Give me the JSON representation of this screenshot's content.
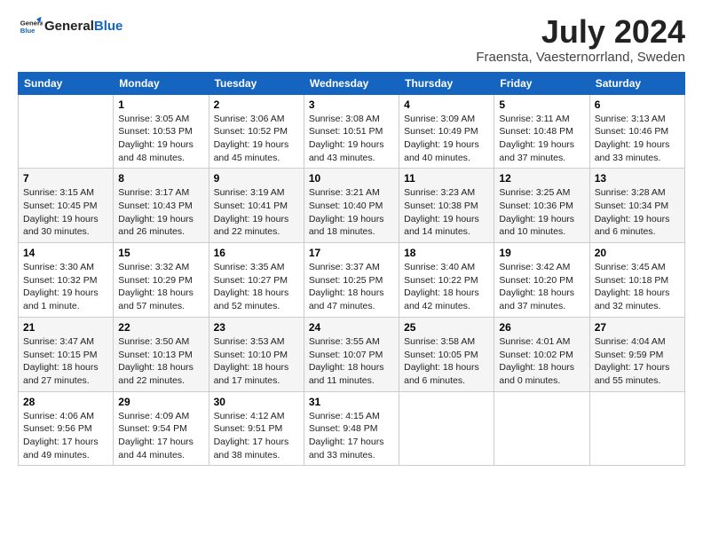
{
  "header": {
    "logo_line1": "General",
    "logo_line2": "Blue",
    "month_title": "July 2024",
    "location": "Fraensta, Vaesternorrland, Sweden"
  },
  "days_of_week": [
    "Sunday",
    "Monday",
    "Tuesday",
    "Wednesday",
    "Thursday",
    "Friday",
    "Saturday"
  ],
  "weeks": [
    [
      {
        "day": "",
        "info": ""
      },
      {
        "day": "1",
        "info": "Sunrise: 3:05 AM\nSunset: 10:53 PM\nDaylight: 19 hours\nand 48 minutes."
      },
      {
        "day": "2",
        "info": "Sunrise: 3:06 AM\nSunset: 10:52 PM\nDaylight: 19 hours\nand 45 minutes."
      },
      {
        "day": "3",
        "info": "Sunrise: 3:08 AM\nSunset: 10:51 PM\nDaylight: 19 hours\nand 43 minutes."
      },
      {
        "day": "4",
        "info": "Sunrise: 3:09 AM\nSunset: 10:49 PM\nDaylight: 19 hours\nand 40 minutes."
      },
      {
        "day": "5",
        "info": "Sunrise: 3:11 AM\nSunset: 10:48 PM\nDaylight: 19 hours\nand 37 minutes."
      },
      {
        "day": "6",
        "info": "Sunrise: 3:13 AM\nSunset: 10:46 PM\nDaylight: 19 hours\nand 33 minutes."
      }
    ],
    [
      {
        "day": "7",
        "info": "Sunrise: 3:15 AM\nSunset: 10:45 PM\nDaylight: 19 hours\nand 30 minutes."
      },
      {
        "day": "8",
        "info": "Sunrise: 3:17 AM\nSunset: 10:43 PM\nDaylight: 19 hours\nand 26 minutes."
      },
      {
        "day": "9",
        "info": "Sunrise: 3:19 AM\nSunset: 10:41 PM\nDaylight: 19 hours\nand 22 minutes."
      },
      {
        "day": "10",
        "info": "Sunrise: 3:21 AM\nSunset: 10:40 PM\nDaylight: 19 hours\nand 18 minutes."
      },
      {
        "day": "11",
        "info": "Sunrise: 3:23 AM\nSunset: 10:38 PM\nDaylight: 19 hours\nand 14 minutes."
      },
      {
        "day": "12",
        "info": "Sunrise: 3:25 AM\nSunset: 10:36 PM\nDaylight: 19 hours\nand 10 minutes."
      },
      {
        "day": "13",
        "info": "Sunrise: 3:28 AM\nSunset: 10:34 PM\nDaylight: 19 hours\nand 6 minutes."
      }
    ],
    [
      {
        "day": "14",
        "info": "Sunrise: 3:30 AM\nSunset: 10:32 PM\nDaylight: 19 hours\nand 1 minute."
      },
      {
        "day": "15",
        "info": "Sunrise: 3:32 AM\nSunset: 10:29 PM\nDaylight: 18 hours\nand 57 minutes."
      },
      {
        "day": "16",
        "info": "Sunrise: 3:35 AM\nSunset: 10:27 PM\nDaylight: 18 hours\nand 52 minutes."
      },
      {
        "day": "17",
        "info": "Sunrise: 3:37 AM\nSunset: 10:25 PM\nDaylight: 18 hours\nand 47 minutes."
      },
      {
        "day": "18",
        "info": "Sunrise: 3:40 AM\nSunset: 10:22 PM\nDaylight: 18 hours\nand 42 minutes."
      },
      {
        "day": "19",
        "info": "Sunrise: 3:42 AM\nSunset: 10:20 PM\nDaylight: 18 hours\nand 37 minutes."
      },
      {
        "day": "20",
        "info": "Sunrise: 3:45 AM\nSunset: 10:18 PM\nDaylight: 18 hours\nand 32 minutes."
      }
    ],
    [
      {
        "day": "21",
        "info": "Sunrise: 3:47 AM\nSunset: 10:15 PM\nDaylight: 18 hours\nand 27 minutes."
      },
      {
        "day": "22",
        "info": "Sunrise: 3:50 AM\nSunset: 10:13 PM\nDaylight: 18 hours\nand 22 minutes."
      },
      {
        "day": "23",
        "info": "Sunrise: 3:53 AM\nSunset: 10:10 PM\nDaylight: 18 hours\nand 17 minutes."
      },
      {
        "day": "24",
        "info": "Sunrise: 3:55 AM\nSunset: 10:07 PM\nDaylight: 18 hours\nand 11 minutes."
      },
      {
        "day": "25",
        "info": "Sunrise: 3:58 AM\nSunset: 10:05 PM\nDaylight: 18 hours\nand 6 minutes."
      },
      {
        "day": "26",
        "info": "Sunrise: 4:01 AM\nSunset: 10:02 PM\nDaylight: 18 hours\nand 0 minutes."
      },
      {
        "day": "27",
        "info": "Sunrise: 4:04 AM\nSunset: 9:59 PM\nDaylight: 17 hours\nand 55 minutes."
      }
    ],
    [
      {
        "day": "28",
        "info": "Sunrise: 4:06 AM\nSunset: 9:56 PM\nDaylight: 17 hours\nand 49 minutes."
      },
      {
        "day": "29",
        "info": "Sunrise: 4:09 AM\nSunset: 9:54 PM\nDaylight: 17 hours\nand 44 minutes."
      },
      {
        "day": "30",
        "info": "Sunrise: 4:12 AM\nSunset: 9:51 PM\nDaylight: 17 hours\nand 38 minutes."
      },
      {
        "day": "31",
        "info": "Sunrise: 4:15 AM\nSunset: 9:48 PM\nDaylight: 17 hours\nand 33 minutes."
      },
      {
        "day": "",
        "info": ""
      },
      {
        "day": "",
        "info": ""
      },
      {
        "day": "",
        "info": ""
      }
    ]
  ]
}
